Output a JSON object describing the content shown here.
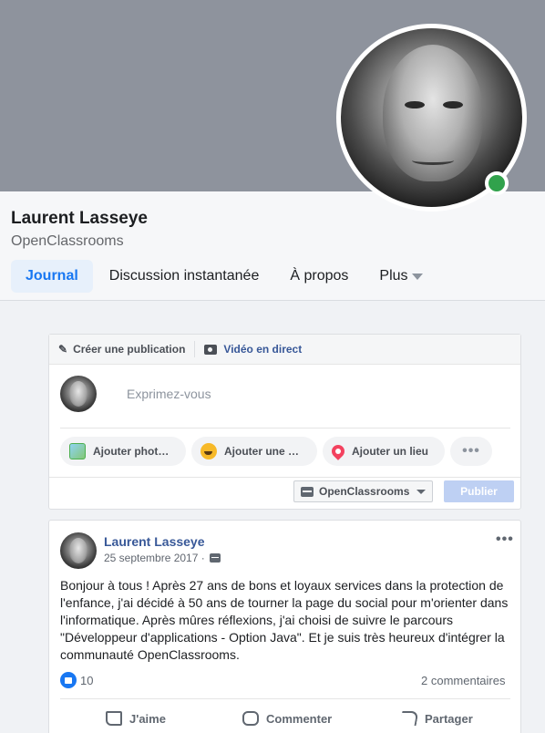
{
  "profile": {
    "name": "Laurent Lasseye",
    "subtitle": "OpenClassrooms",
    "status": "online"
  },
  "tabs": [
    {
      "label": "Journal",
      "active": true
    },
    {
      "label": "Discussion instantanée",
      "active": false
    },
    {
      "label": "À propos",
      "active": false
    },
    {
      "label": "Plus",
      "active": false
    }
  ],
  "composer": {
    "create_label": "Créer une publication",
    "video_label": "Vidéo en direct",
    "placeholder": "Exprimez-vous",
    "actions": [
      "Ajouter phot…",
      "Ajouter une …",
      "Ajouter un lieu"
    ],
    "more": "•••",
    "audience": "OpenClassrooms",
    "publish": "Publier"
  },
  "post": {
    "author": "Laurent Lasseye",
    "date": "25 septembre 2017 ·",
    "more": "•••",
    "text": "Bonjour à tous ! Après 27 ans de bons et loyaux services dans la protection de l'enfance, j'ai décidé à 50 ans de tourner la page du social pour m'orienter dans l'informatique. Après mûres réflexions, j'ai choisi de suivre le parcours \"Développeur d'applications - Option Java\". Et je suis très heureux d'intégrer la communauté OpenClassrooms.",
    "likes": "10",
    "comments": "2 commentaires",
    "actions": [
      "J'aime",
      "Commenter",
      "Partager"
    ]
  }
}
